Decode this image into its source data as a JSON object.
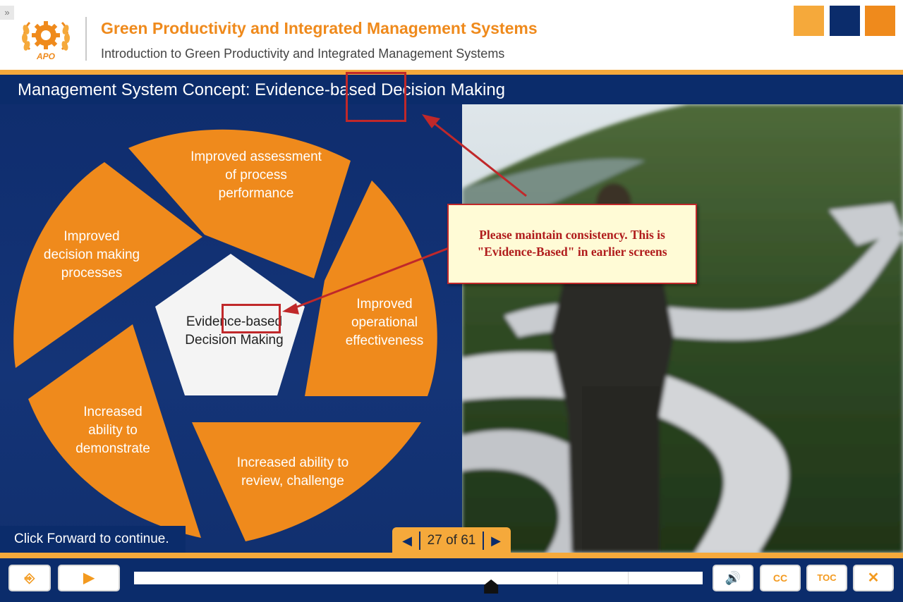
{
  "header": {
    "expand_glyph": "»",
    "logo_text": "APO",
    "course_title": "Green Productivity and Integrated Management Systems",
    "course_subtitle": "Introduction to Green Productivity and Integrated Management Systems",
    "brand_colors": [
      "#f5a93b",
      "#0b2c6b",
      "#ef8a1c"
    ]
  },
  "slide": {
    "title": "Management System Concept: Evidence-based Decision Making",
    "center": {
      "line1": "Evidence-based",
      "line2": "Decision Making"
    },
    "segments": [
      {
        "lines": [
          "Improved assessment",
          "of process",
          "performance"
        ]
      },
      {
        "lines": [
          "Improved",
          "operational",
          "effectiveness"
        ]
      },
      {
        "lines": [
          "Increased ability to",
          "review, challenge"
        ]
      },
      {
        "lines": [
          "Increased",
          "ability to",
          "demonstrate"
        ]
      },
      {
        "lines": [
          "Improved",
          "decision making",
          "processes"
        ]
      }
    ],
    "continue_text": "Click Forward to continue.",
    "pager": {
      "prev_icon": "◀",
      "next_icon": "▶",
      "text": "27 of 61"
    }
  },
  "annotation": {
    "line1": "Please maintain consistency. This is",
    "line2": "\"Evidence-Based\" in earlier screens",
    "color": "#c0282a"
  },
  "player": {
    "exit_icon": "exit-icon",
    "exit_glyph": "⎆",
    "play_glyph": "▶",
    "volume_glyph": "🔊",
    "cc_label": "CC",
    "toc_label": "TOC",
    "close_glyph": "✕",
    "progress": 0.628
  },
  "colors": {
    "orange": "#ef8a1c",
    "navy": "#0b2c6b",
    "light_orange": "#f5a93b"
  }
}
